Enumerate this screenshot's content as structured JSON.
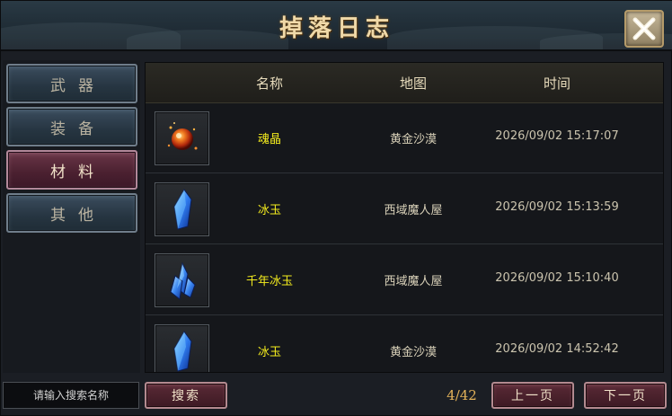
{
  "window": {
    "title": "掉落日志"
  },
  "sidebar": {
    "items": [
      {
        "label": "武器",
        "active": false
      },
      {
        "label": "装备",
        "active": false
      },
      {
        "label": "材料",
        "active": true
      },
      {
        "label": "其他",
        "active": false
      }
    ]
  },
  "table": {
    "headers": {
      "name": "名称",
      "map": "地图",
      "time": "时间"
    },
    "rows": [
      {
        "icon": "soul-crystal-icon",
        "name": "魂晶",
        "map": "黄金沙漠",
        "time": "2026/09/02 15:17:07"
      },
      {
        "icon": "ice-jade-icon",
        "name": "冰玉",
        "map": "西域魔人屋",
        "time": "2026/09/02 15:13:59"
      },
      {
        "icon": "millennium-ice-jade-icon",
        "name": "千年冰玉",
        "map": "西域魔人屋",
        "time": "2026/09/02 15:10:40"
      },
      {
        "icon": "ice-jade-icon",
        "name": "冰玉",
        "map": "黄金沙漠",
        "time": "2026/09/02 14:52:42"
      }
    ]
  },
  "footer": {
    "search_placeholder": "请输入搜索名称",
    "search_button": "搜索",
    "page_indicator": "4/42",
    "prev_button": "上一页",
    "next_button": "下一页"
  },
  "colors": {
    "title": "#f0d9a8",
    "item_name": "#f4ec1e",
    "active_tab": "#4a2030",
    "page_indicator": "#e3b25a"
  }
}
